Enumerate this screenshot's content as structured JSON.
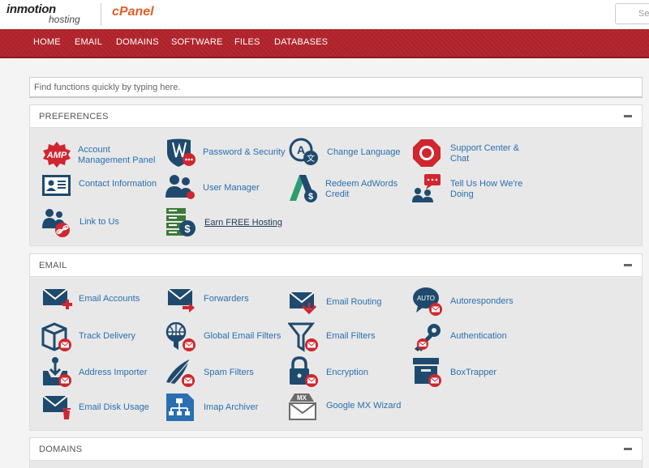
{
  "brand": {
    "inmotion_line1": "inmotion",
    "inmotion_line2": "hosting",
    "cpanel": "cPanel"
  },
  "top_search": {
    "placeholder": "Sea"
  },
  "nav": {
    "items": [
      "HOME",
      "EMAIL",
      "DOMAINS",
      "SOFTWARE",
      "FILES",
      "DATABASES"
    ]
  },
  "quick_search": {
    "placeholder": "Find functions quickly by typing here."
  },
  "preferences": {
    "title": "PREFERENCES",
    "items": [
      {
        "label": "Account Management Panel",
        "icon": "amp-icon"
      },
      {
        "label": "Password & Security",
        "icon": "shield-icon"
      },
      {
        "label": "Change Language",
        "icon": "language-icon"
      },
      {
        "label": "Support Center & Chat",
        "icon": "lifebuoy-icon"
      },
      {
        "label": "Contact Information",
        "icon": "contact-card-icon"
      },
      {
        "label": "User Manager",
        "icon": "users-icon"
      },
      {
        "label": "Redeem AdWords Credit",
        "icon": "adwords-icon"
      },
      {
        "label": "Tell Us How We're Doing",
        "icon": "feedback-icon"
      },
      {
        "label": "Link to Us",
        "icon": "link-users-icon"
      },
      {
        "label": "Earn FREE Hosting",
        "icon": "server-dollar-icon"
      }
    ]
  },
  "email": {
    "title": "EMAIL",
    "items": [
      {
        "label": "Email Accounts",
        "icon": "email-accounts-icon"
      },
      {
        "label": "Forwarders",
        "icon": "forwarders-icon"
      },
      {
        "label": "Email Routing",
        "icon": "email-routing-icon"
      },
      {
        "label": "Autoresponders",
        "icon": "autoresponders-icon",
        "badge": "AUTO"
      },
      {
        "label": "Track Delivery",
        "icon": "track-delivery-icon"
      },
      {
        "label": "Global Email Filters",
        "icon": "global-filter-icon"
      },
      {
        "label": "Email Filters",
        "icon": "email-filter-icon"
      },
      {
        "label": "Authentication",
        "icon": "key-icon"
      },
      {
        "label": "Address Importer",
        "icon": "address-importer-icon"
      },
      {
        "label": "Spam Filters",
        "icon": "spam-filter-icon"
      },
      {
        "label": "Encryption",
        "icon": "lock-icon"
      },
      {
        "label": "BoxTrapper",
        "icon": "boxtrapper-icon"
      },
      {
        "label": "Email Disk Usage",
        "icon": "disk-usage-icon"
      },
      {
        "label": "Imap Archiver",
        "icon": "archiver-icon"
      },
      {
        "label": "Google MX Wizard",
        "icon": "mx-wizard-icon",
        "badge": "MX"
      }
    ]
  },
  "domains": {
    "title": "DOMAINS"
  },
  "colors": {
    "nav_red": "#b3232b",
    "icon_navy": "#1f4a6e",
    "icon_red": "#d0262f",
    "link_blue": "#2a6fb0"
  }
}
